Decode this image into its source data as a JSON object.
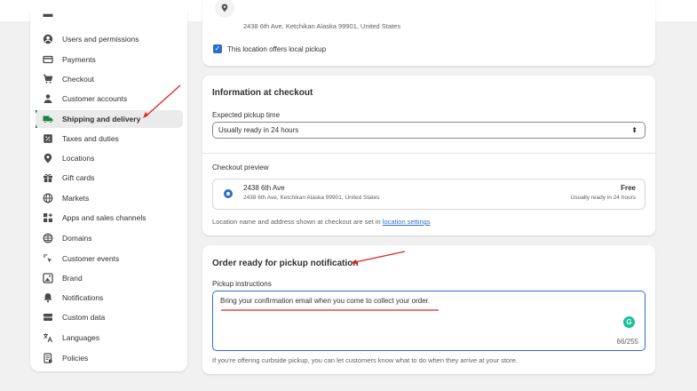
{
  "sidebar": {
    "items": [
      {
        "label": "Users and permissions",
        "icon": "user-circle-icon"
      },
      {
        "label": "Payments",
        "icon": "credit-card-icon"
      },
      {
        "label": "Checkout",
        "icon": "cart-icon"
      },
      {
        "label": "Customer accounts",
        "icon": "person-icon"
      },
      {
        "label": "Shipping and delivery",
        "icon": "truck-icon",
        "active": true
      },
      {
        "label": "Taxes and duties",
        "icon": "tax-icon"
      },
      {
        "label": "Locations",
        "icon": "location-pin-icon"
      },
      {
        "label": "Gift cards",
        "icon": "gift-icon"
      },
      {
        "label": "Markets",
        "icon": "globe-icon"
      },
      {
        "label": "Apps and sales channels",
        "icon": "apps-icon"
      },
      {
        "label": "Domains",
        "icon": "domain-globe-icon"
      },
      {
        "label": "Customer events",
        "icon": "sparkle-cursor-icon"
      },
      {
        "label": "Brand",
        "icon": "brand-icon"
      },
      {
        "label": "Notifications",
        "icon": "bell-icon"
      },
      {
        "label": "Custom data",
        "icon": "database-icon"
      },
      {
        "label": "Languages",
        "icon": "translate-icon"
      },
      {
        "label": "Policies",
        "icon": "document-icon"
      }
    ]
  },
  "location_card": {
    "address": "2438 6th Ave, Ketchikan Alaska 99901, United States",
    "local_pickup_label": "This location offers local pickup",
    "local_pickup_checked": true
  },
  "checkout_card": {
    "title": "Information at checkout",
    "pickup_time_label": "Expected pickup time",
    "pickup_time_value": "Usually ready in 24 hours",
    "preview_label": "Checkout preview",
    "preview_name": "2438 6th Ave",
    "preview_address": "2438 6th Ave, Ketchikan Alaska 99901, United States",
    "preview_price": "Free",
    "preview_ready": "Usually ready in 24 hours",
    "footer_text": "Location name and address shown at checkout are set in ",
    "footer_link": "location settings"
  },
  "notification_card": {
    "title": "Order ready for pickup notification",
    "instructions_label": "Pickup instructions",
    "instructions_value": "Bring your confirmation email when you come to collect your order.",
    "char_count": "66/255",
    "help_text": "If you're offering curbside pickup, you can let customers know what to do when they arrive at your store."
  },
  "colors": {
    "accent_blue": "#2c6ecb",
    "active_green": "#1a7f4b",
    "annotation_red": "#e02424"
  }
}
